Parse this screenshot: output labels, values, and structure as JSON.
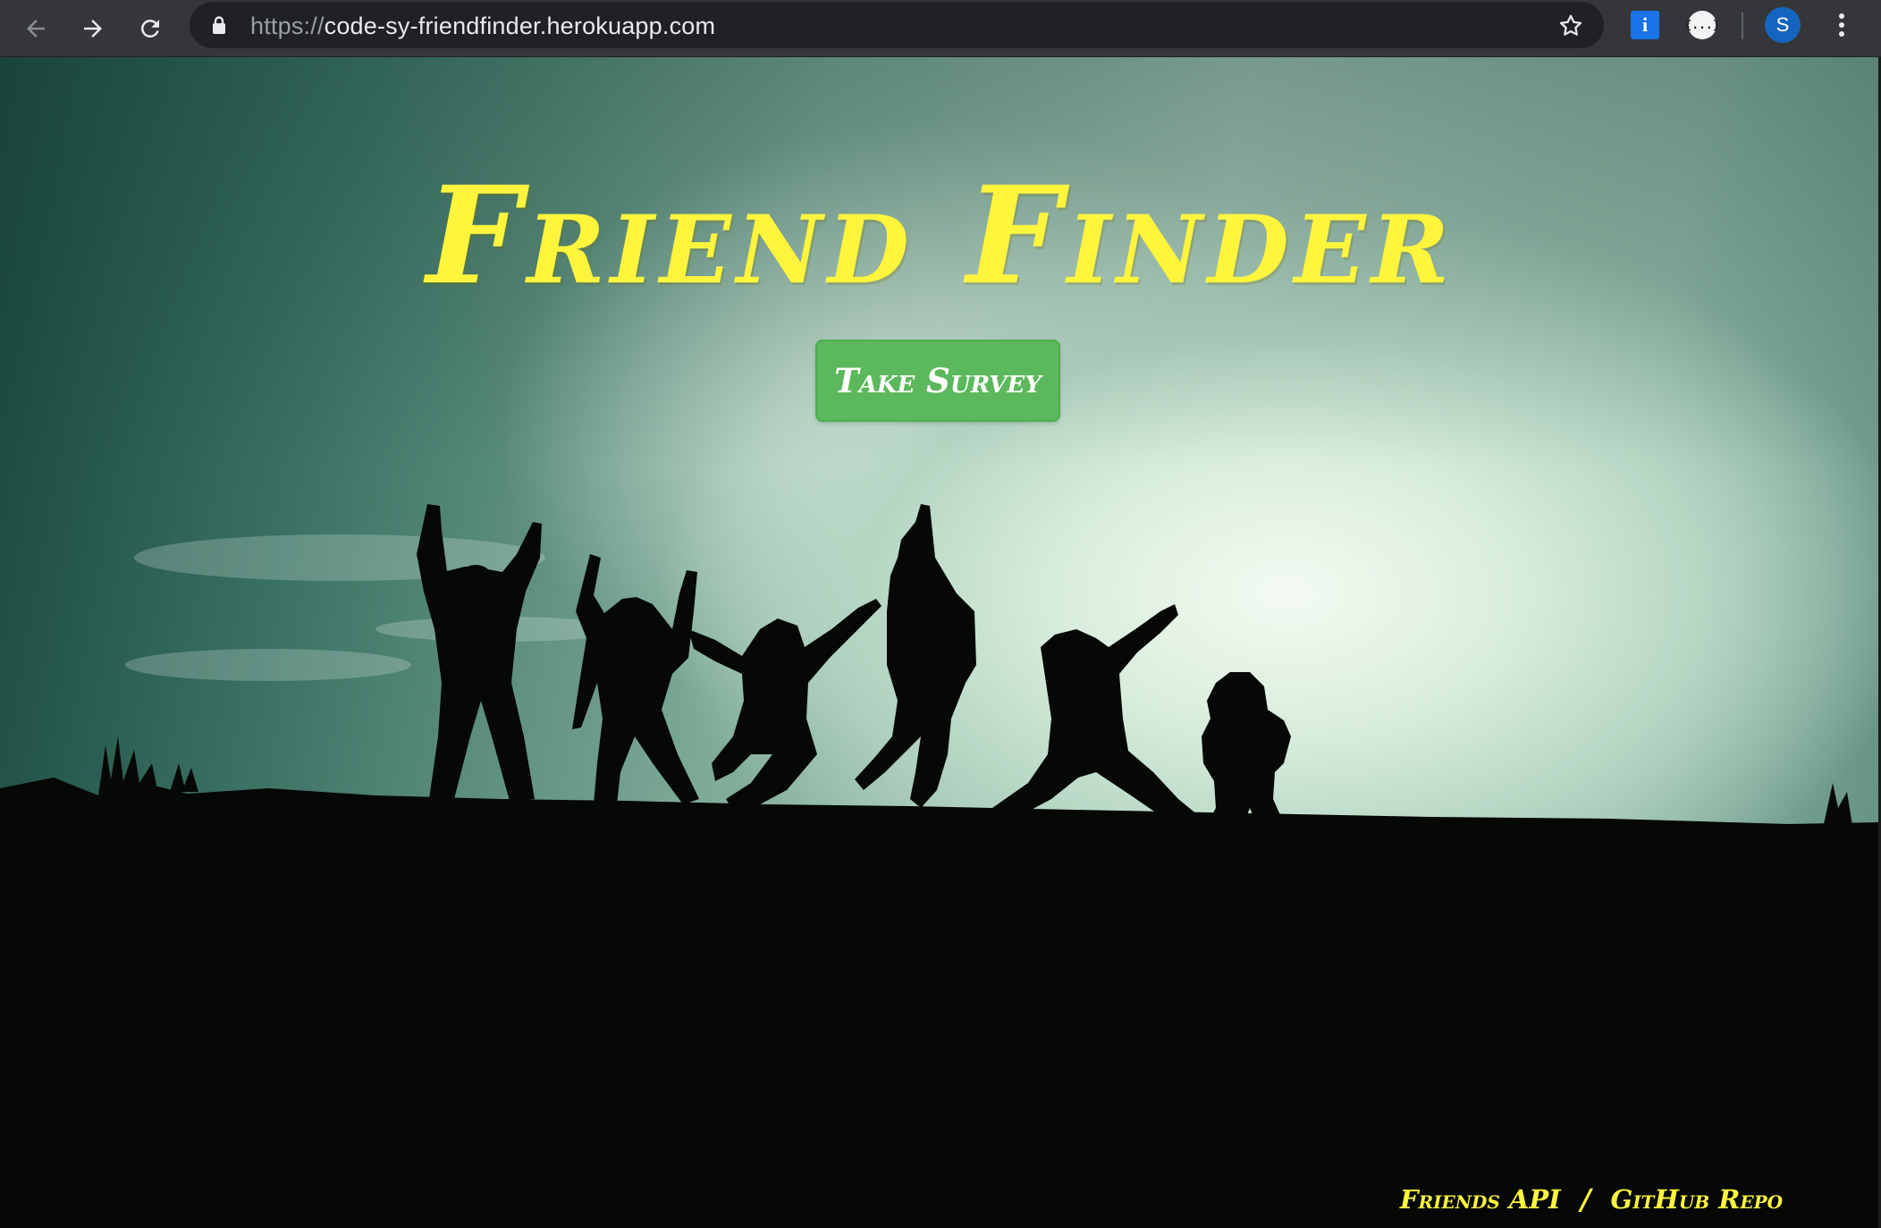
{
  "browser": {
    "url_scheme": "https://",
    "url_host": "code-sy-friendfinder.herokuapp.com",
    "profile_initial": "S",
    "json_ext_glyph": "{...}",
    "info_ext_glyph": "i"
  },
  "hero": {
    "title": "Friend Finder",
    "survey_button": "Take Survey"
  },
  "footer": {
    "api_link": "Friends API",
    "separator": "/",
    "repo_link": "GitHub Repo"
  },
  "colors": {
    "title_yellow": "#fff53d",
    "button_green": "#5cb85c",
    "chrome_bg": "#35363a"
  }
}
